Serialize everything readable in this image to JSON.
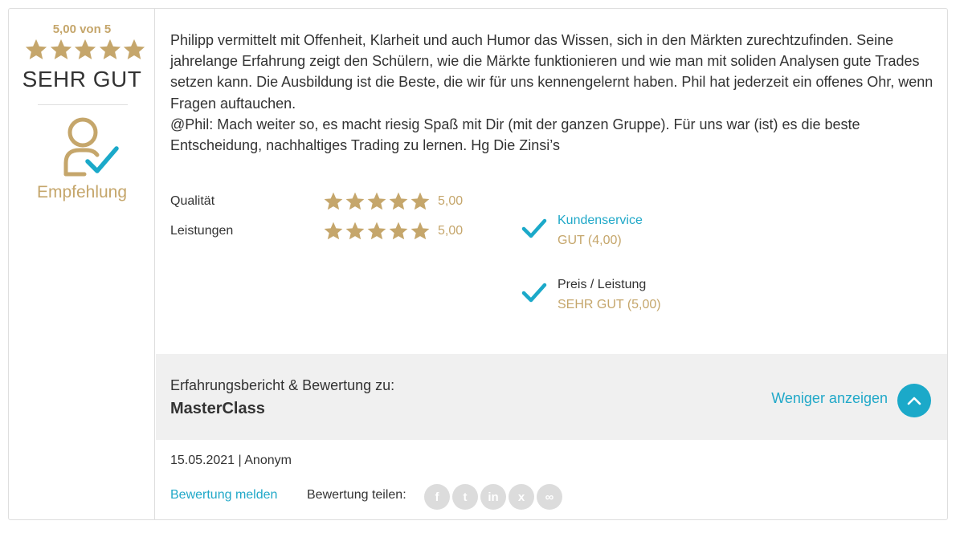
{
  "summary": {
    "score_text": "5,00 von 5",
    "stars": 5,
    "verdict": "SEHR GUT",
    "recommendation": "Empfehlung",
    "icon": "user-check-icon"
  },
  "review": {
    "paragraph1": "Philipp vermittelt mit Offenheit, Klarheit und auch Humor das Wissen, sich in den Märkten zurechtzufinden. Seine jahrelange Erfahrung zeigt den Schülern, wie die Märkte funktionieren und wie man mit soliden Analysen gute Trades setzen kann. Die Ausbildung ist die Beste, die wir für uns kennengelernt haben. Phil hat jederzeit ein offenes Ohr, wenn Fragen auftauchen.",
    "paragraph2": "@Phil: Mach weiter so, es macht riesig Spaß mit Dir (mit der ganzen Gruppe). Für uns war (ist) es die beste Entscheidung, nachhaltiges Trading zu lernen. Hg Die Zinsi’s"
  },
  "ratings": [
    {
      "label": "Qualität",
      "stars": 5,
      "value": "5,00"
    },
    {
      "label": "Leistungen",
      "stars": 5,
      "value": "5,00"
    }
  ],
  "checks": [
    {
      "title": "Kundenservice",
      "grade": "GUT (4,00)",
      "icon": "checkmark-icon"
    },
    {
      "title": "Preis / Leistung",
      "grade": "SEHR GUT (5,00)",
      "icon": "checkmark-icon"
    }
  ],
  "product": {
    "label": "Erfahrungsbericht & Bewertung zu:",
    "name": "MasterClass",
    "less_link": "Weniger anzeigen",
    "collapse_icon": "chevron-up-icon"
  },
  "footer": {
    "meta": "15.05.2021 | Anonym",
    "report": "Bewertung melden",
    "share_label": "Bewertung teilen:",
    "share_icons": [
      {
        "name": "facebook-icon",
        "glyph": "f"
      },
      {
        "name": "twitter-icon",
        "glyph": "t"
      },
      {
        "name": "linkedin-icon",
        "glyph": "in"
      },
      {
        "name": "xing-icon",
        "glyph": "x"
      },
      {
        "name": "link-icon",
        "glyph": "∞"
      }
    ]
  },
  "colors": {
    "gold": "#c5a66b",
    "accent": "#1ba9c9",
    "link": "#20a8c8",
    "bar_bg": "#f0f0f0",
    "border": "#dedede"
  }
}
